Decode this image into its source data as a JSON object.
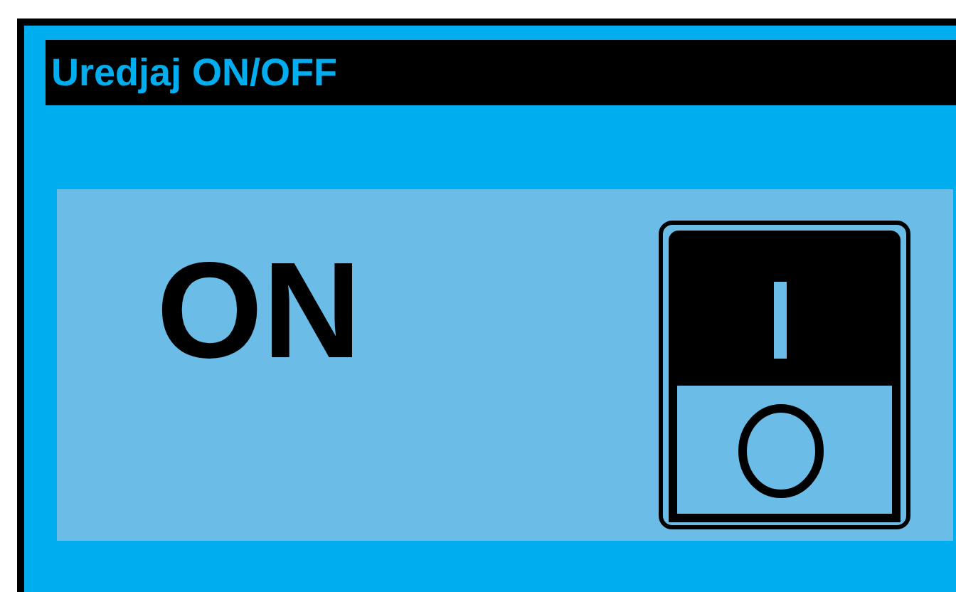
{
  "title": "Uredjaj ON/OFF",
  "device": {
    "status_label": "ON",
    "on": true
  }
}
